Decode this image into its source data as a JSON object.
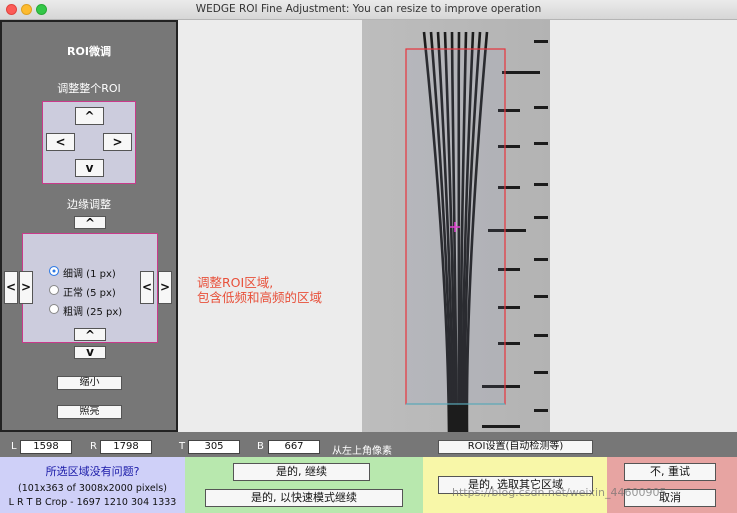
{
  "window": {
    "title": "WEDGE ROI Fine Adjustment: You can resize to improve operation"
  },
  "left_panel": {
    "heading": "ROI微调",
    "move_roi_label": "调整整个ROI",
    "up": "^",
    "down": "v",
    "left": "<",
    "right": ">",
    "edge_label": "边缘调整",
    "step_options": [
      {
        "label": "细调 (1 px)",
        "selected": true
      },
      {
        "label": "正常 (5 px)",
        "selected": false
      },
      {
        "label": "粗调 (25 px)",
        "selected": false
      }
    ],
    "shrink_button": "缩小",
    "brighten_button": "照亮"
  },
  "image_view": {
    "annotation_line1": "调整ROI区域,",
    "annotation_line2": "包含低频和高频的区域",
    "roi_color": "#e8343c",
    "annotation_color": "#e8503a"
  },
  "coords": {
    "l_label": "L",
    "l_value": "1598",
    "r_label": "R",
    "r_value": "1798",
    "t_label": "T",
    "t_value": "305",
    "b_label": "B",
    "b_value": "667",
    "hint": "从左上角像素",
    "auto_detect_button": "ROI设置(自动检测等)"
  },
  "bottom": {
    "question": "所选区域没有问题?",
    "size_info": "(101x363 of 3008x2000 pixels)",
    "crop_info": "L R T B Crop  -  1697  1210  304  1333",
    "yes_continue": "是的, 继续",
    "yes_fast": "是的, 以快速模式继续",
    "yes_other": "是的, 选取其它区域",
    "no_retry": "不, 重试",
    "cancel": "取消",
    "watermark": "https://blog.csdn.net/weixin_44600905",
    "colors": {
      "blue": "#cfd0f8",
      "green": "#b8e8ae",
      "yellow": "#f8f7a8",
      "red": "#e7a4a2"
    }
  }
}
